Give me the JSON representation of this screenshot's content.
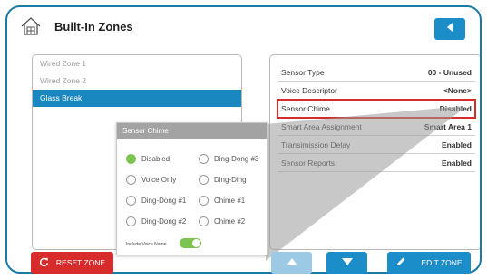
{
  "header": {
    "title": "Built-In Zones"
  },
  "zones": [
    {
      "label": "Wired Zone 1",
      "selected": false
    },
    {
      "label": "Wired Zone 2",
      "selected": false
    },
    {
      "label": "Glass Break",
      "selected": true
    }
  ],
  "properties": [
    {
      "label": "Sensor Type",
      "value": "00 - Unused",
      "highlighted": false
    },
    {
      "label": "Voice Descriptor",
      "value": "<None>",
      "highlighted": false
    },
    {
      "label": "Sensor Chime",
      "value": "Disabled",
      "highlighted": true
    },
    {
      "label": "Smart Area Assignment",
      "value": "Smart Area 1",
      "highlighted": false
    },
    {
      "label": "Transimission Delay",
      "value": "Enabled",
      "highlighted": false
    },
    {
      "label": "Sensor Reports",
      "value": "Enabled",
      "highlighted": false
    }
  ],
  "popup": {
    "title": "Sensor Chime",
    "options": [
      "Disabled",
      "Voice Only",
      "Ding-Dong #1",
      "Ding-Dong #2",
      "Ding-Dong #3",
      "Ding-Ding",
      "Chime #1",
      "Chime #2"
    ],
    "selected": "Disabled",
    "include_voice_label": "Include Voice Name",
    "include_voice_on": true
  },
  "buttons": {
    "reset": "RESET ZONE",
    "edit": "EDIT ZONE"
  },
  "colors": {
    "accent": "#1b8ec9",
    "danger": "#d82b2b",
    "toggle_on": "#7bc44f",
    "highlight": "#d62b2b"
  },
  "icons": [
    "home-icon",
    "back-arrow-icon",
    "reset-icon",
    "up-arrow-icon",
    "down-arrow-icon",
    "pencil-icon"
  ]
}
